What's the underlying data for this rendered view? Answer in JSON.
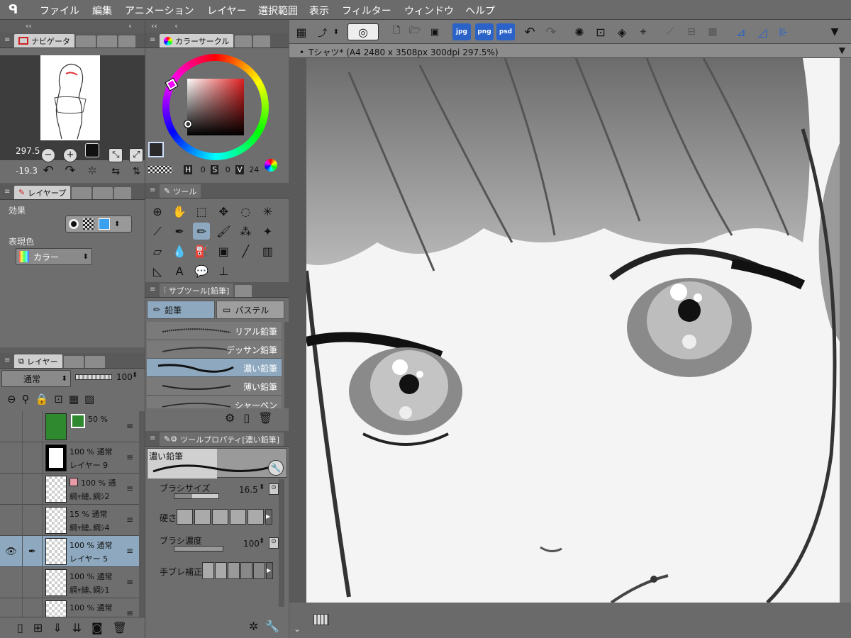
{
  "menubar": {
    "items": [
      "ファイル",
      "編集",
      "アニメーション",
      "レイヤー",
      "選択範囲",
      "表示",
      "フィルター",
      "ウィンドウ",
      "ヘルプ"
    ]
  },
  "navigator": {
    "tab_label": "ナビゲータ",
    "zoom_value": "297.5",
    "rotate_value": "-19.3"
  },
  "layer_property": {
    "tab_label": "レイヤープ",
    "effect_label": "効果",
    "expression_color_label": "表現色",
    "color_mode": "カラー"
  },
  "layers": {
    "tab_label": "レイヤー",
    "blend_mode": "通常",
    "opacity": "100",
    "rows": [
      {
        "line1": "50 %",
        "line2": ""
      },
      {
        "line1": "100 % 通常",
        "line2": "レイヤー 9"
      },
      {
        "line1": "100 % 通",
        "line2": "綱ｬ縺､綱ｼ2"
      },
      {
        "line1": "15 % 通常",
        "line2": "綱ｬ縺､綱ｼ4"
      },
      {
        "line1": "100 % 通常",
        "line2": "レイヤー 5"
      },
      {
        "line1": "100 % 通常",
        "line2": "綱ｬ縺､綱ｼ1"
      },
      {
        "line1": "100 % 通常",
        "line2": ""
      }
    ]
  },
  "color_circle": {
    "tab_label": "カラーサークル",
    "h_value": "0",
    "s_value": "0",
    "v_value": "24",
    "main_color": "#2a2a2a"
  },
  "tools": {
    "tab_label": "ツール"
  },
  "subtool": {
    "tab_label": "サブツール[鉛筆]",
    "group_pencil": "鉛筆",
    "group_pastel": "パステル",
    "brushes": [
      "リアル鉛筆",
      "デッサン鉛筆",
      "濃い鉛筆",
      "薄い鉛筆",
      "シャーペン"
    ]
  },
  "tool_property": {
    "tab_label": "ツールプロパティ[濃い鉛筆]",
    "preview_label": "濃い鉛筆",
    "brush_size_label": "ブラシサイズ",
    "brush_size_value": "16.5",
    "hardness_label": "硬さ",
    "density_label": "ブラシ濃度",
    "density_value": "100",
    "stabilization_label": "手ブレ補正"
  },
  "document": {
    "title": "Tシャツ* (A4 2480 x 3508px 300dpi 297.5%)"
  },
  "toolbar": {
    "jpg": "jpg",
    "png": "png",
    "psd": "psd"
  },
  "colors": {
    "accent": "#2a62c8",
    "selection": "#8ea9bf",
    "layer_green": "#2f8a2f"
  }
}
